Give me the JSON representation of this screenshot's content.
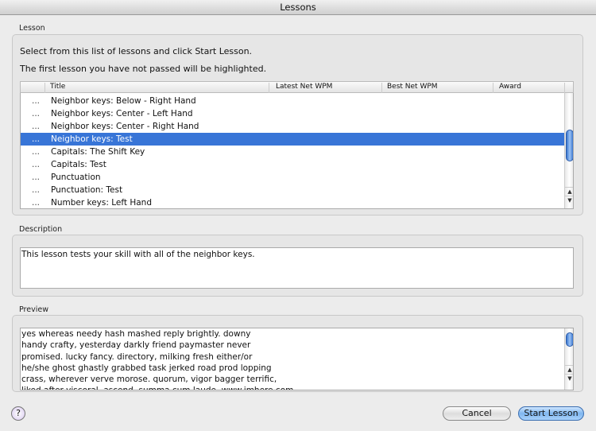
{
  "window": {
    "title": "Lessons"
  },
  "lesson_group": {
    "label": "Lesson",
    "instruction1": "Select from this list of lessons and click Start Lesson.",
    "instruction2": "The first lesson you have not passed will be highlighted.",
    "columns": [
      "Title",
      "Latest Net WPM",
      "Best Net WPM",
      "Award"
    ],
    "rows": [
      {
        "status": "...",
        "title": "Neighbor keys: Below - Right Hand"
      },
      {
        "status": "...",
        "title": "Neighbor keys: Center - Left Hand"
      },
      {
        "status": "...",
        "title": "Neighbor keys: Center - Right Hand"
      },
      {
        "status": "...",
        "title": "Neighbor keys: Test",
        "selected": true
      },
      {
        "status": "...",
        "title": "Capitals: The Shift Key"
      },
      {
        "status": "...",
        "title": "Capitals: Test"
      },
      {
        "status": "...",
        "title": "Punctuation"
      },
      {
        "status": "...",
        "title": "Punctuation: Test"
      },
      {
        "status": "...",
        "title": "Number keys: Left Hand"
      }
    ]
  },
  "description_group": {
    "label": "Description",
    "text": "This lesson tests your skill with all of the neighbor keys."
  },
  "preview_group": {
    "label": "Preview",
    "lines": [
      "yes whereas needy hash mashed reply brightly. downy",
      "handy crafty, yesterday darkly friend paymaster never",
      "promised. lucky fancy. directory, milking fresh either/or",
      "he/she ghost ghastly grabbed task jerked road prod lopping",
      "crass, wherever verve morose. quorum, vigor bagger terrific,",
      "liked after visceral, ascend. summa cum laude, www.imhere.com"
    ]
  },
  "buttons": {
    "help": "?",
    "cancel": "Cancel",
    "start": "Start Lesson"
  },
  "colors": {
    "selection": "#3875d7",
    "default_button": "#8fc0f0"
  }
}
